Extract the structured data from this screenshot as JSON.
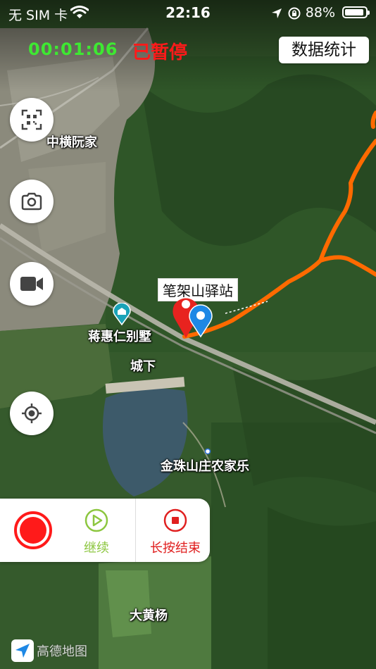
{
  "status_bar": {
    "carrier": "无 SIM 卡",
    "time": "22:16",
    "battery_percent": "88%"
  },
  "tracking": {
    "elapsed": "00:01:06",
    "state": "已暂停"
  },
  "header": {
    "stats_label": "数据统计"
  },
  "side_buttons": [
    "qr-code-icon",
    "camera-icon",
    "video-icon",
    "locate-icon"
  ],
  "map": {
    "labels": {
      "village_1": "中横阮家",
      "villa": "蒋惠仁别墅",
      "village_2": "城下",
      "farm": "金珠山庄农家乐",
      "village_3": "大黄杨"
    },
    "callout": "笔架山驿站",
    "route_color": "#ff6a00",
    "provider": "高德地图"
  },
  "controls": {
    "continue_label": "继续",
    "stop_label": "长按结束",
    "record_color": "#ff1a1a",
    "continue_color": "#8cc63f",
    "stop_color": "#e02020"
  }
}
